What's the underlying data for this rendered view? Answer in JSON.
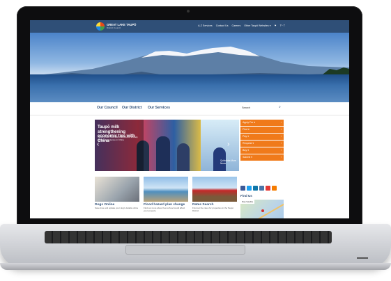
{
  "site": {
    "logo_text": "GREAT LAKE TAUPŌ",
    "logo_sub": "District Council",
    "top_links": [
      "A-Z Services",
      "Contact Us",
      "Careers",
      "Other Taupō Websites ▾",
      "⚑",
      "T⁺ T"
    ],
    "main_nav": [
      "Our Council",
      "Our District",
      "Our Services"
    ],
    "search_label": "Search"
  },
  "slider": {
    "title": "Taupō milk strengthening economic ties with China",
    "text": "Taupō-grown milk and products are actively gaining acceptance in China",
    "side_caption": "Quicklinks\nMore News"
  },
  "menu": {
    "items": [
      "Apply For ▾",
      "Find ▾",
      "Pay ▾",
      "Request ▾",
      "Buy ▾",
      "Submit ▾"
    ]
  },
  "find_us": "Find Us",
  "map_tabs": "Map  Satellite",
  "cards": [
    {
      "title": "Dogs Online",
      "desc": "Save time and update your dog's details online"
    },
    {
      "title": "Flood hazard plan change",
      "desc": "Find out more about how a flood could affect your property"
    },
    {
      "title": "Rates Search",
      "desc": "Find out the rates for properties in the Taupō District"
    }
  ],
  "colors": {
    "navy": "#2f4f77",
    "orange": "#f07a1a"
  }
}
